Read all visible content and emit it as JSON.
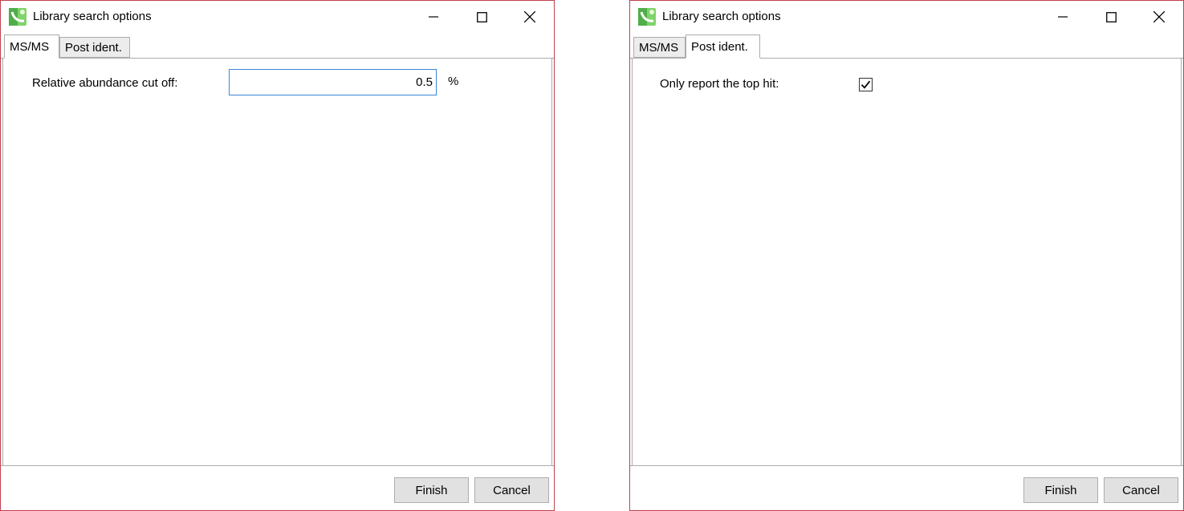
{
  "windows": [
    {
      "title": "Library search options",
      "tabs": [
        {
          "label": "MS/MS",
          "active": true
        },
        {
          "label": "Post ident.",
          "active": false
        }
      ],
      "field": {
        "label": "Relative abundance cut off:",
        "value": "0.5",
        "unit": "%"
      },
      "buttons": {
        "finish": "Finish",
        "cancel": "Cancel"
      }
    },
    {
      "title": "Library search options",
      "tabs": [
        {
          "label": "MS/MS",
          "active": false
        },
        {
          "label": "Post ident.",
          "active": true
        }
      ],
      "field": {
        "label": "Only report the top hit:",
        "checked": true
      },
      "buttons": {
        "finish": "Finish",
        "cancel": "Cancel"
      }
    }
  ],
  "icons": {
    "app": "app-logo-icon",
    "minimize": "minimize-icon",
    "maximize": "maximize-icon",
    "close": "close-icon",
    "check": "checkmark-icon"
  },
  "colors": {
    "window_border": "#c0414f",
    "input_focus_border": "#3c86d8",
    "button_bg": "#e1e1e1",
    "inactive_tab_bg": "#ececec"
  }
}
